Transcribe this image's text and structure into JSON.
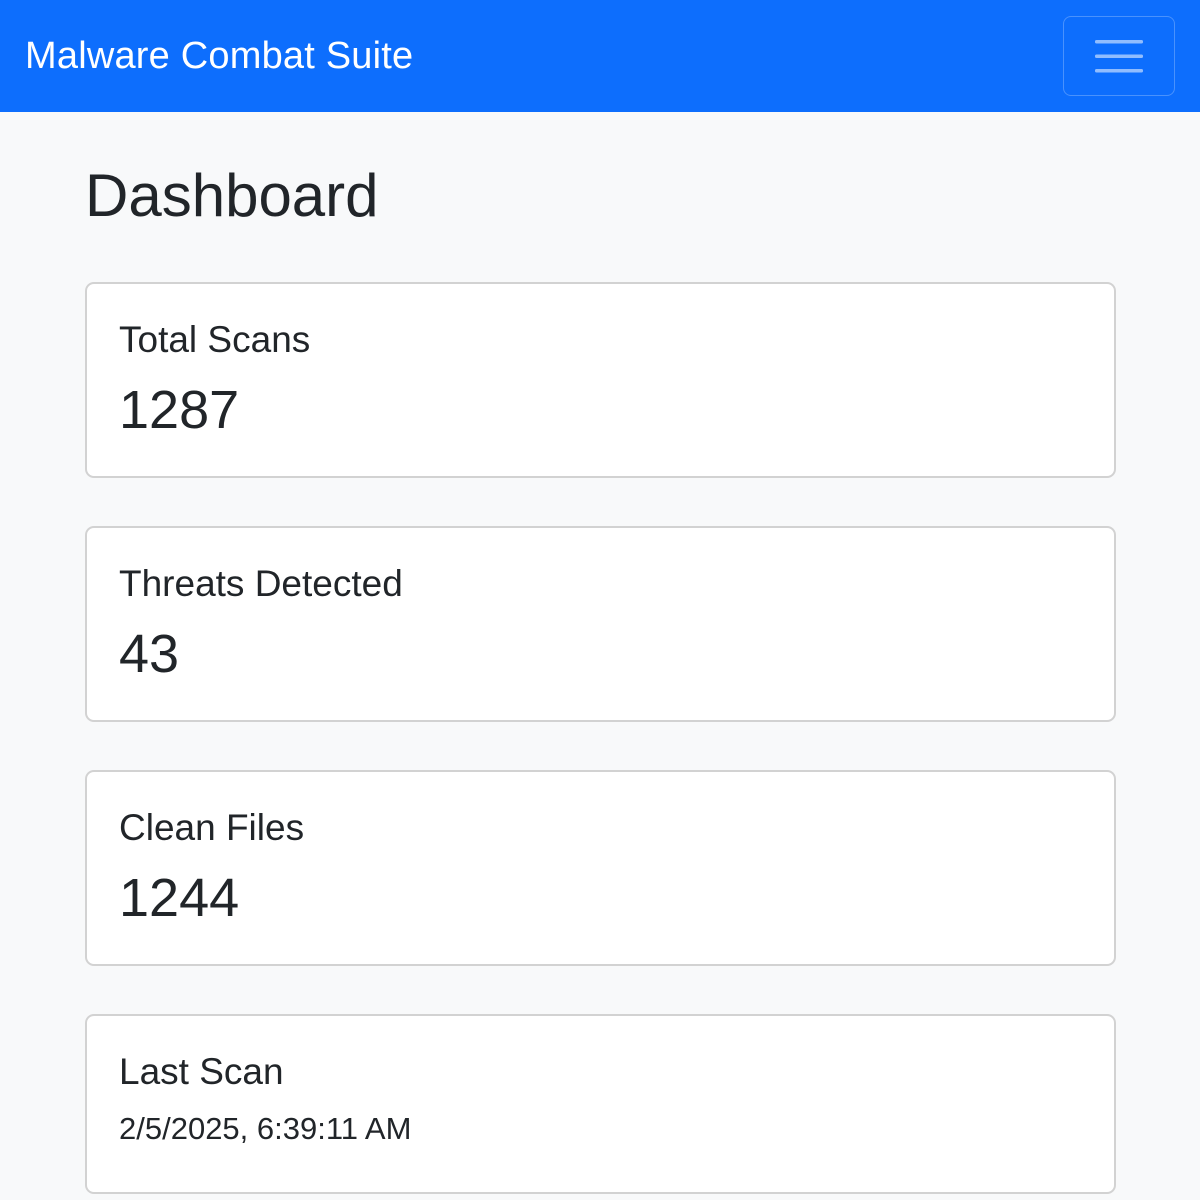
{
  "navbar": {
    "brand": "Malware Combat Suite",
    "toggle_icon": "hamburger-menu-icon",
    "bg_color": "#0d6efd"
  },
  "page": {
    "title": "Dashboard"
  },
  "stats": [
    {
      "label": "Total Scans",
      "value": "1287"
    },
    {
      "label": "Threats Detected",
      "value": "43"
    },
    {
      "label": "Clean Files",
      "value": "1244"
    },
    {
      "label": "Last Scan",
      "value": "2/5/2025, 6:39:11 AM"
    }
  ]
}
